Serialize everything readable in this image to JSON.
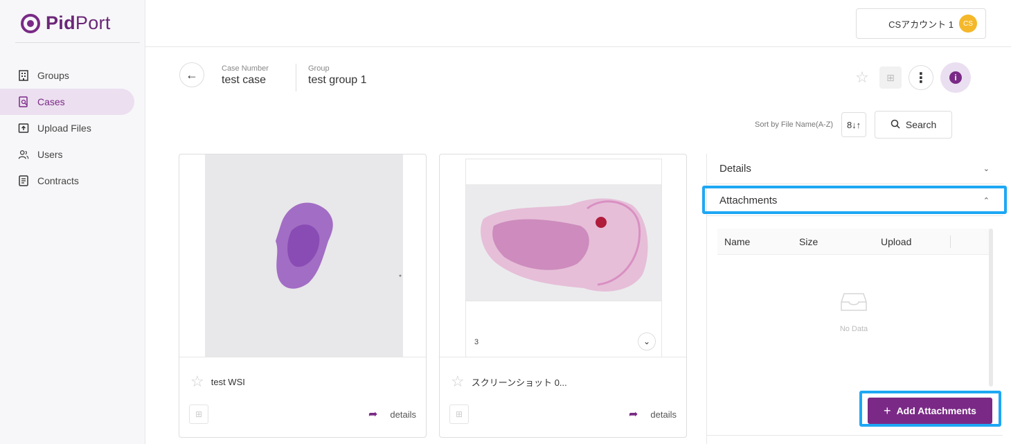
{
  "app": {
    "logo_text_bold": "Pid",
    "logo_text_thin": "Port"
  },
  "sidebar": {
    "items": [
      {
        "label": "Groups",
        "icon": "building-icon"
      },
      {
        "label": "Cases",
        "icon": "case-search-icon",
        "active": true
      },
      {
        "label": "Upload Files",
        "icon": "upload-icon"
      },
      {
        "label": "Users",
        "icon": "users-icon"
      },
      {
        "label": "Contracts",
        "icon": "document-icon"
      }
    ]
  },
  "topbar": {
    "account_name": "CSアカウント 1",
    "avatar_initials": "CS"
  },
  "header": {
    "case_number_label": "Case Number",
    "case_number_value": "test case",
    "group_label": "Group",
    "group_value": "test group 1"
  },
  "toolbar": {
    "sort_label": "Sort by File Name(A-Z)",
    "sort_icon_text": "8↓↑",
    "search_label": "Search"
  },
  "cards": [
    {
      "title": "test WSI",
      "details_label": "details"
    },
    {
      "title": "スクリーンショット 0...",
      "page_number": "3",
      "details_label": "details"
    }
  ],
  "panel": {
    "details_label": "Details",
    "attachments_label": "Attachments",
    "columns": [
      "Name",
      "Size",
      "Upload"
    ],
    "empty_text": "No Data",
    "add_button_label": "Add Attachments"
  },
  "colors": {
    "brand": "#7a2a86",
    "highlight": "#1ea7f4",
    "avatar": "#f4b82a"
  }
}
